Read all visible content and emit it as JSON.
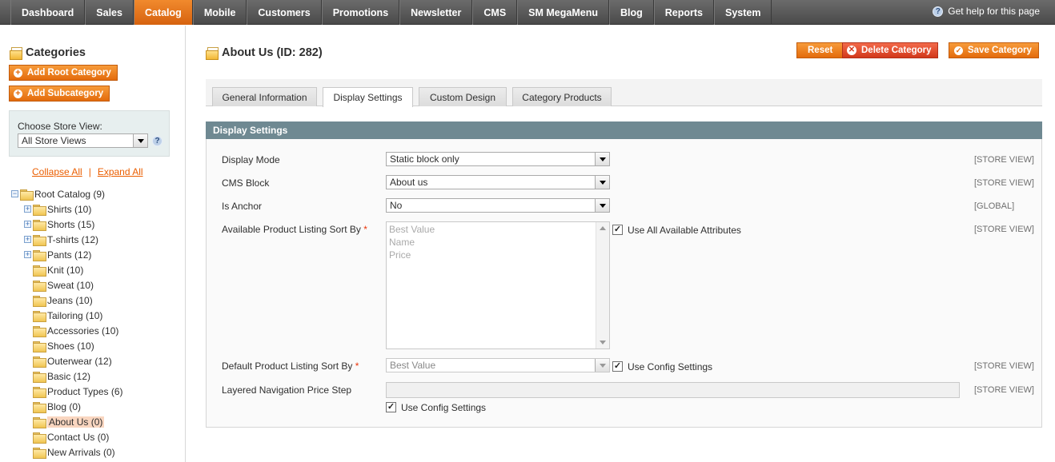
{
  "nav": {
    "items": [
      "Dashboard",
      "Sales",
      "Catalog",
      "Mobile",
      "Customers",
      "Promotions",
      "Newsletter",
      "CMS",
      "SM MegaMenu",
      "Blog",
      "Reports",
      "System"
    ],
    "active_index": 2,
    "help_text": "Get help for this page"
  },
  "sidebar": {
    "title": "Categories",
    "add_root_label": "Add Root Category",
    "add_sub_label": "Add Subcategory",
    "store_label": "Choose Store View:",
    "store_value": "All Store Views",
    "collapse_all": "Collapse All",
    "expand_all": "Expand All",
    "link_separator": "|",
    "tree": [
      {
        "label": "Root Catalog (9)",
        "level": 0,
        "expander": "minus"
      },
      {
        "label": "Shirts (10)",
        "level": 1,
        "expander": "plus"
      },
      {
        "label": "Shorts (15)",
        "level": 1,
        "expander": "plus"
      },
      {
        "label": "T-shirts (12)",
        "level": 1,
        "expander": "plus"
      },
      {
        "label": "Pants (12)",
        "level": 1,
        "expander": "plus"
      },
      {
        "label": "Knit (10)",
        "level": 1,
        "expander": ""
      },
      {
        "label": "Sweat (10)",
        "level": 1,
        "expander": ""
      },
      {
        "label": "Jeans (10)",
        "level": 1,
        "expander": ""
      },
      {
        "label": "Tailoring (10)",
        "level": 1,
        "expander": ""
      },
      {
        "label": "Accessories (10)",
        "level": 1,
        "expander": ""
      },
      {
        "label": "Shoes (10)",
        "level": 1,
        "expander": ""
      },
      {
        "label": "Outerwear (12)",
        "level": 1,
        "expander": ""
      },
      {
        "label": "Basic (12)",
        "level": 1,
        "expander": ""
      },
      {
        "label": "Product Types (6)",
        "level": 1,
        "expander": ""
      },
      {
        "label": "Blog (0)",
        "level": 1,
        "expander": ""
      },
      {
        "label": "About Us (0)",
        "level": 1,
        "expander": "",
        "selected": true
      },
      {
        "label": "Contact Us (0)",
        "level": 1,
        "expander": ""
      },
      {
        "label": "New Arrivals (0)",
        "level": 1,
        "expander": ""
      }
    ]
  },
  "main": {
    "title": "About Us (ID: 282)",
    "reset_label": "Reset",
    "delete_label": "Delete Category",
    "save_label": "Save Category",
    "tabs": [
      "General Information",
      "Display Settings",
      "Custom Design",
      "Category Products"
    ],
    "active_tab": 1,
    "section_title": "Display Settings"
  },
  "form": {
    "display_mode": {
      "label": "Display Mode",
      "value": "Static block only",
      "scope": "[STORE VIEW]"
    },
    "cms_block": {
      "label": "CMS Block",
      "value": "About us",
      "scope": "[STORE VIEW]"
    },
    "is_anchor": {
      "label": "Is Anchor",
      "value": "No",
      "scope": "[GLOBAL]"
    },
    "available_sort": {
      "label": "Available Product Listing Sort By",
      "required_mark": "*",
      "options": [
        "Best Value",
        "Name",
        "Price"
      ],
      "use_all_label": "Use All Available Attributes",
      "use_all_checked": true,
      "scope": "[STORE VIEW]"
    },
    "default_sort": {
      "label": "Default Product Listing Sort By",
      "required_mark": "*",
      "value": "Best Value",
      "use_config_label": "Use Config Settings",
      "use_config_checked": true,
      "scope": "[STORE VIEW]"
    },
    "price_step": {
      "label": "Layered Navigation Price Step",
      "value": "",
      "use_config_label": "Use Config Settings",
      "use_config_checked": true,
      "scope": "[STORE VIEW]"
    }
  },
  "colors": {
    "accent": "#eb5e00",
    "section_header": "#6f8992",
    "nav_bg": "#555555"
  }
}
